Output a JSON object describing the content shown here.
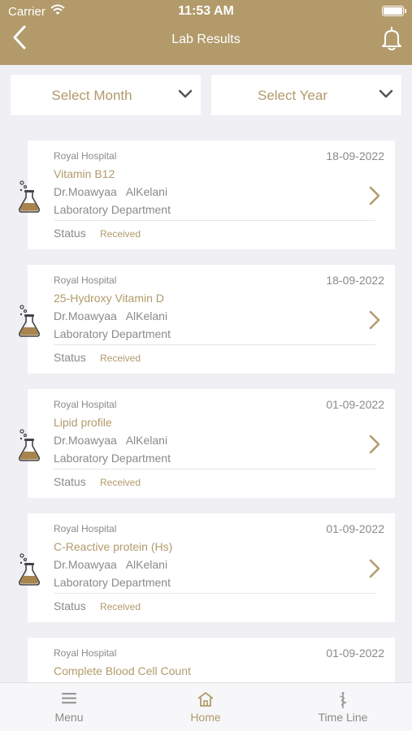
{
  "status_bar": {
    "carrier": "Carrier",
    "time": "11:53 AM"
  },
  "header": {
    "title": "Lab Results"
  },
  "filters": {
    "month": "Select Month",
    "year": "Select Year"
  },
  "cards": [
    {
      "hospital": "Royal Hospital",
      "date": "18-09-2022",
      "test": "Vitamin B12",
      "doctor": "Dr.Moawyaa   AlKelani",
      "department": "Laboratory Department",
      "status_label": "Status",
      "status": "Received"
    },
    {
      "hospital": "Royal Hospital",
      "date": "18-09-2022",
      "test": "25-Hydroxy Vitamin D",
      "doctor": "Dr.Moawyaa   AlKelani",
      "department": "Laboratory Department",
      "status_label": "Status",
      "status": "Received"
    },
    {
      "hospital": "Royal Hospital",
      "date": "01-09-2022",
      "test": "Lipid profile",
      "doctor": "Dr.Moawyaa   AlKelani",
      "department": "Laboratory Department",
      "status_label": "Status",
      "status": "Received"
    },
    {
      "hospital": "Royal Hospital",
      "date": "01-09-2022",
      "test": "C-Reactive protein (Hs)",
      "doctor": "Dr.Moawyaa   AlKelani",
      "department": "Laboratory Department",
      "status_label": "Status",
      "status": "Received"
    },
    {
      "hospital": "Royal Hospital",
      "date": "01-09-2022",
      "test": "Complete Blood Cell Count",
      "doctor": "",
      "department": "",
      "status_label": "",
      "status": ""
    }
  ],
  "tabs": [
    {
      "label": "Menu",
      "icon": "menu-icon",
      "active": false
    },
    {
      "label": "Home",
      "icon": "home-icon",
      "active": true
    },
    {
      "label": "Time Line",
      "icon": "caduceus-icon",
      "active": false
    }
  ],
  "colors": {
    "accent": "#b29a6b",
    "background": "#efeff4",
    "text_muted": "#8a8a8a"
  }
}
